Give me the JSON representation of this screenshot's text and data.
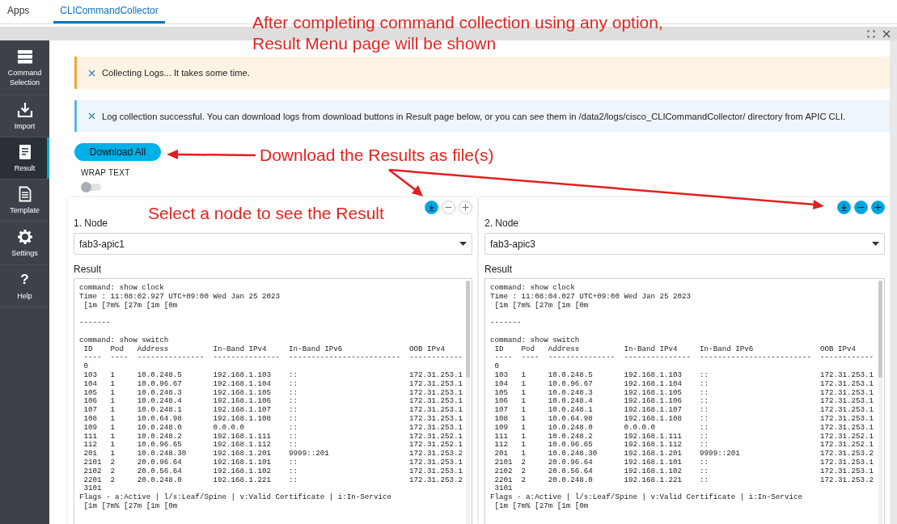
{
  "tabs": [
    {
      "label": "Apps",
      "selected": false
    },
    {
      "label": "CLICommandCollector",
      "selected": true
    }
  ],
  "sidebar": {
    "items": [
      {
        "label": "Command Selection",
        "selected": false
      },
      {
        "label": "Import",
        "selected": false
      },
      {
        "label": "Result",
        "selected": true
      },
      {
        "label": "Template",
        "selected": false
      },
      {
        "label": "Settings",
        "selected": false
      },
      {
        "glyph": "?",
        "label": "Help",
        "selected": false
      }
    ]
  },
  "alerts": [
    {
      "kind": "warning",
      "text": "Collecting Logs... It takes some time."
    },
    {
      "kind": "info",
      "text": "Log collection successful. You can download logs from download buttons in Result page below, or you can see them in /data2/logs/cisco_CLICommandCollector/ directory from APIC CLI."
    }
  ],
  "download_all": "Download All",
  "wrap_text": {
    "label": "WRAP TEXT",
    "on": false
  },
  "panels": [
    {
      "actions": [
        {
          "kind": "download",
          "disabled": false
        },
        {
          "kind": "minus",
          "disabled": true
        },
        {
          "kind": "plus",
          "disabled": true
        }
      ],
      "node_label": "1. Node",
      "node": "fab3-apic1",
      "result_label": "Result",
      "output": {
        "blocks": [
          [
            {
              "text": "command: show clock",
              "indent": false
            },
            {
              "text": "Time : 11:08:02.927 UTC+09:00 Wed Jan 25 2023",
              "indent": false
            },
            {
              "text": "[1m [7m% [27m [1m [0m",
              "indent": true
            }
          ],
          [
            {
              "text": "-------",
              "indent": false
            }
          ],
          [
            {
              "text": "command: show switch",
              "indent": false
            }
          ]
        ],
        "columns": [
          "ID",
          "Pod",
          "Address",
          "In-Band IPv4",
          "In-Band IPv6",
          "OOB IPv4"
        ],
        "rules": [
          "----",
          "----",
          "---------------",
          "---------------",
          "-------------------------",
          "------------"
        ],
        "rows": [
          [
            "0"
          ],
          [
            "103",
            "1",
            "10.0.248.5",
            "192.168.1.103",
            "::",
            "172.31.253.1"
          ],
          [
            "104",
            "1",
            "10.0.96.67",
            "192.168.1.104",
            "::",
            "172.31.253.1"
          ],
          [
            "105",
            "1",
            "10.0.248.3",
            "192.168.1.105",
            "::",
            "172.31.253.1"
          ],
          [
            "106",
            "1",
            "10.0.248.4",
            "192.168.1.106",
            "::",
            "172.31.253.1"
          ],
          [
            "107",
            "1",
            "10.0.248.1",
            "192.168.1.107",
            "::",
            "172.31.253.1"
          ],
          [
            "108",
            "1",
            "10.0.64.98",
            "192.168.1.108",
            "::",
            "172.31.253.1"
          ],
          [
            "109",
            "1",
            "10.0.248.0",
            "0.0.0.0",
            "::",
            "172.31.253.1"
          ],
          [
            "111",
            "1",
            "10.0.248.2",
            "192.168.1.111",
            "::",
            "172.31.252.1"
          ],
          [
            "112",
            "1",
            "10.0.96.65",
            "192.168.1.112",
            "::",
            "172.31.252.1"
          ],
          [
            "201",
            "1",
            "10.0.248.30",
            "192.168.1.201",
            "9999::201",
            "172.31.253.2"
          ],
          [
            "2101",
            "2",
            "20.0.96.64",
            "192.168.1.101",
            "::",
            "172.31.253.1"
          ],
          [
            "2102",
            "2",
            "20.0.56.64",
            "192.168.1.102",
            "::",
            "172.31.253.1"
          ],
          [
            "2201",
            "2",
            "20.0.248.0",
            "192.168.1.221",
            "::",
            "172.31.253.2"
          ],
          [
            "3101"
          ]
        ],
        "post_lines": [
          {
            "text": "Flags - a:Active | l/s:Leaf/Spine | v:Valid Certificate | i:In-Service",
            "indent": false
          },
          {
            "text": "[1m [7m% [27m [1m [0m",
            "indent": true
          }
        ]
      }
    },
    {
      "actions": [
        {
          "kind": "download",
          "disabled": false
        },
        {
          "kind": "minus",
          "disabled": false
        },
        {
          "kind": "plus",
          "disabled": false
        }
      ],
      "node_label": "2. Node",
      "node": "fab3-apic3",
      "result_label": "Result",
      "output": {
        "blocks": [
          [
            {
              "text": "command: show clock",
              "indent": false
            },
            {
              "text": "Time : 11:08:04.027 UTC+09:00 Wed Jan 25 2023",
              "indent": false
            },
            {
              "text": "[1m [7m% [27m [1m [0m",
              "indent": true
            }
          ],
          [
            {
              "text": "-------",
              "indent": false
            }
          ],
          [
            {
              "text": "command: show switch",
              "indent": false
            }
          ]
        ],
        "columns": [
          "ID",
          "Pod",
          "Address",
          "In-Band IPv4",
          "In-Band IPv6",
          "OOB IPv4"
        ],
        "rules": [
          "----",
          "----",
          "---------------",
          "---------------",
          "-------------------------",
          "------------"
        ],
        "rows": [
          [
            "0"
          ],
          [
            "103",
            "1",
            "10.0.248.5",
            "192.168.1.103",
            "::",
            "172.31.253.1"
          ],
          [
            "104",
            "1",
            "10.0.96.67",
            "192.168.1.104",
            "::",
            "172.31.253.1"
          ],
          [
            "105",
            "1",
            "10.0.248.3",
            "192.168.1.105",
            "::",
            "172.31.253.1"
          ],
          [
            "106",
            "1",
            "10.0.248.4",
            "192.168.1.106",
            "::",
            "172.31.253.1"
          ],
          [
            "107",
            "1",
            "10.0.248.1",
            "192.168.1.107",
            "::",
            "172.31.253.1"
          ],
          [
            "108",
            "1",
            "10.0.64.98",
            "192.168.1.108",
            "::",
            "172.31.253.1"
          ],
          [
            "109",
            "1",
            "10.0.248.0",
            "0.0.0.0",
            "::",
            "172.31.253.1"
          ],
          [
            "111",
            "1",
            "10.0.248.2",
            "192.168.1.111",
            "::",
            "172.31.252.1"
          ],
          [
            "112",
            "1",
            "10.0.96.65",
            "192.168.1.112",
            "::",
            "172.31.252.1"
          ],
          [
            "201",
            "1",
            "10.0.248.30",
            "192.168.1.201",
            "9999::201",
            "172.31.253.2"
          ],
          [
            "2101",
            "2",
            "20.0.96.64",
            "192.168.1.101",
            "::",
            "172.31.253.1"
          ],
          [
            "2102",
            "2",
            "20.0.56.64",
            "192.168.1.102",
            "::",
            "172.31.253.1"
          ],
          [
            "2201",
            "2",
            "20.0.248.0",
            "192.168.1.221",
            "::",
            "172.31.253.2"
          ],
          [
            "3101"
          ]
        ],
        "post_lines": [
          {
            "text": "Flags - a:Active | l/s:Leaf/Spine | v:Valid Certificate | i:In-Service",
            "indent": false
          },
          {
            "text": "[1m [7m% [27m [1m [0m",
            "indent": true
          }
        ]
      }
    }
  ],
  "annotations": [
    {
      "kind": "heading",
      "lines": [
        "After completing command collection using any option,",
        "Result Menu page will be shown"
      ]
    },
    {
      "kind": "download",
      "lines": [
        "Download the Results as file(s)"
      ]
    },
    {
      "kind": "select",
      "lines": [
        "Select a node to see the Result"
      ]
    }
  ]
}
